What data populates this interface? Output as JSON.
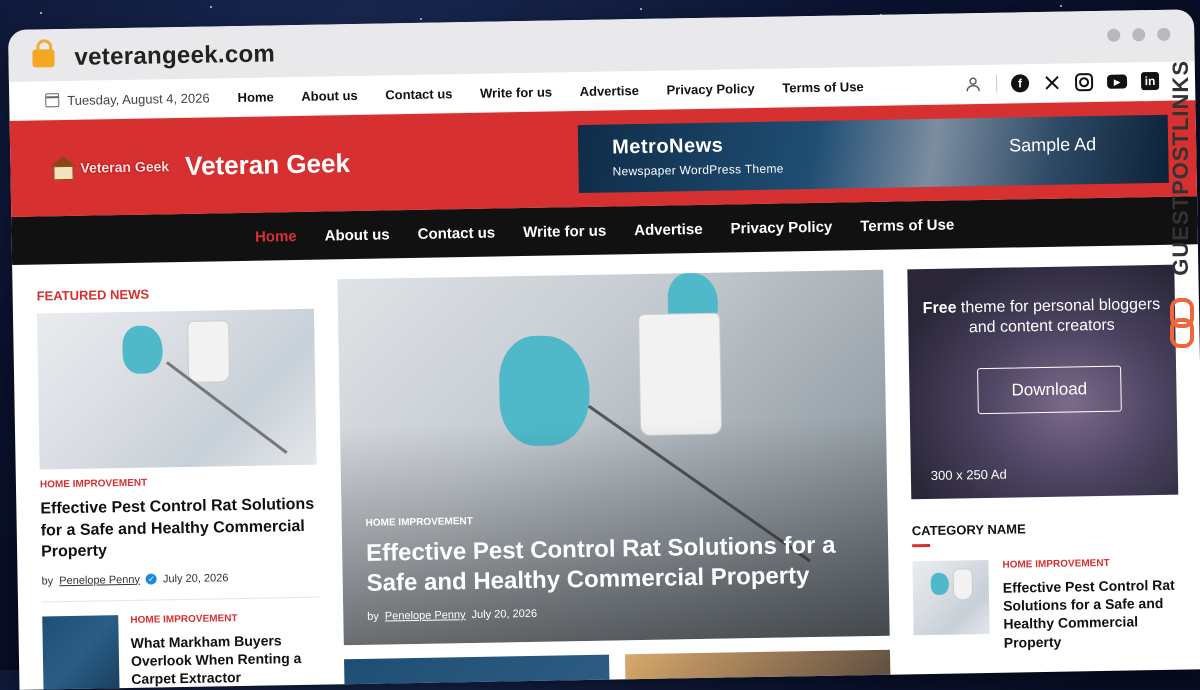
{
  "browser": {
    "url": "veterangeek.com"
  },
  "topbar": {
    "date": "Tuesday, August 4, 2026",
    "links": [
      "Home",
      "About us",
      "Contact us",
      "Write for us",
      "Advertise",
      "Privacy Policy",
      "Terms of Use"
    ]
  },
  "header": {
    "logo_text": "Veteran Geek",
    "site_title": "Veteran Geek",
    "ad": {
      "title": "MetroNews",
      "subtitle": "Newspaper WordPress Theme",
      "tag": "Sample Ad"
    }
  },
  "mainnav": {
    "items": [
      "Home",
      "About us",
      "Contact us",
      "Write for us",
      "Advertise",
      "Privacy Policy",
      "Terms of Use"
    ],
    "active": "Home"
  },
  "featured": {
    "section_title": "FEATURED NEWS",
    "main_post": {
      "category": "HOME IMPROVEMENT",
      "title": "Effective Pest Control Rat Solutions for a Safe and Healthy Commercial Property",
      "by": "by",
      "author": "Penelope Penny",
      "date": "July 20, 2026"
    },
    "second_post": {
      "category": "HOME IMPROVEMENT",
      "title": "What Markham Buyers Overlook When Renting a Carpet Extractor"
    }
  },
  "hero": {
    "category": "HOME IMPROVEMENT",
    "title": "Effective Pest Control Rat Solutions for a Safe and Healthy Commercial Property",
    "by": "by",
    "author": "Penelope Penny",
    "date": "July 20, 2026"
  },
  "sidebar": {
    "ad": {
      "bold": "Free",
      "text": "theme for personal bloggers and content creators",
      "button": "Download",
      "size": "300 x 250 Ad"
    },
    "category_title": "CATEGORY NAME",
    "post": {
      "category": "HOME IMPROVEMENT",
      "title": "Effective Pest Control Rat Solutions for a Safe and Healthy Commercial Property"
    }
  },
  "watermark": "GUESTPOSTLINKS",
  "colors": {
    "accent": "#d63031",
    "nav_bg": "#111111"
  }
}
